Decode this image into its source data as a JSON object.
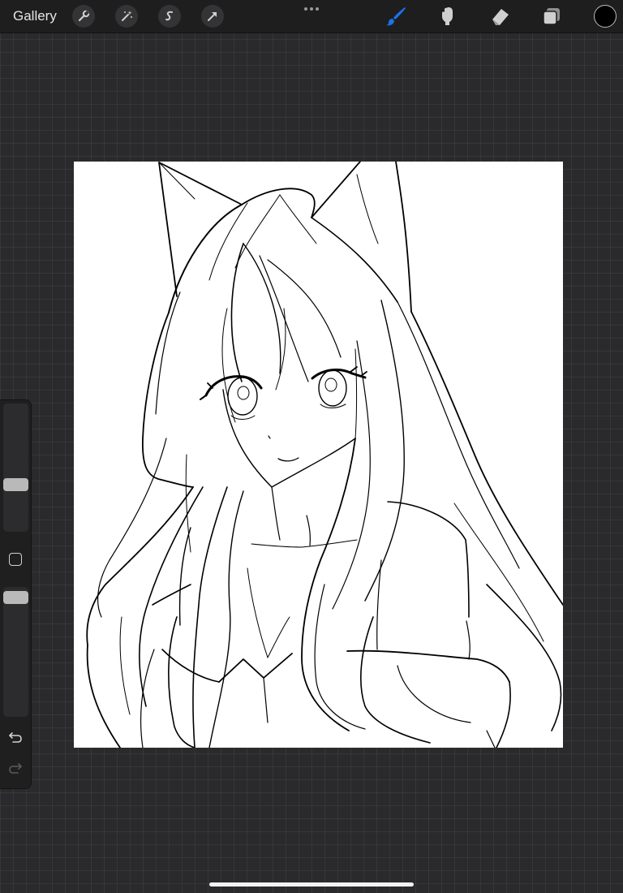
{
  "topbar": {
    "gallery_label": "Gallery",
    "left_tools": [
      "wrench-icon",
      "magic-wand-icon",
      "selection-icon",
      "transform-arrow-icon"
    ],
    "more_icon": "ellipsis-icon",
    "right_tools": {
      "brush": "brush-icon",
      "smudge": "smudge-icon",
      "eraser": "eraser-icon",
      "layers": "layers-icon"
    },
    "active_tool": "brush",
    "active_color": "#1a73e8",
    "current_color": "#000000"
  },
  "sidebar": {
    "brush_size_icon": "brush-size-slider",
    "modifier_icon": "modify-square-icon",
    "opacity_icon": "opacity-slider",
    "undo_icon": "undo-icon",
    "redo_icon": "redo-icon"
  },
  "canvas": {
    "background": "#ffffff",
    "artwork": "line-art-cat-ear-girl"
  }
}
